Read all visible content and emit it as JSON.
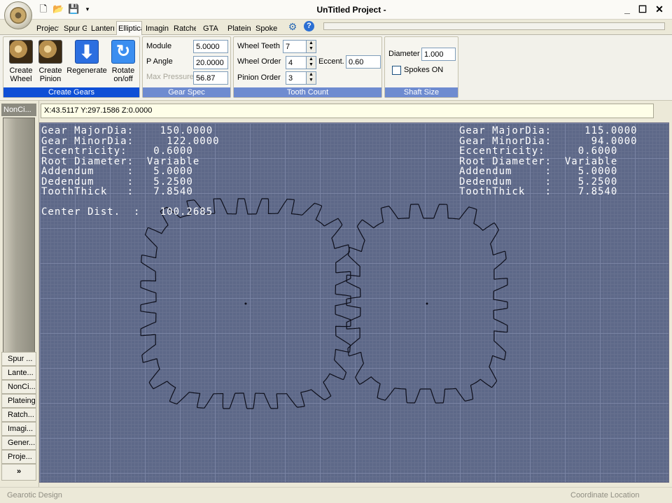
{
  "app": {
    "title": "UnTitled Project -"
  },
  "quick_access": {
    "new_icon": "new-file-icon",
    "open_icon": "open-folder-icon",
    "save_icon": "save-icon",
    "dropdown_icon": "dropdown-icon"
  },
  "tabs": [
    {
      "label": "Project"
    },
    {
      "label": "Spur G"
    },
    {
      "label": "Lantern"
    },
    {
      "label": "Elliptical"
    },
    {
      "label": "Imagin"
    },
    {
      "label": "Ratchet"
    },
    {
      "label": "GTA"
    },
    {
      "label": "Platein"
    },
    {
      "label": "Spoke"
    }
  ],
  "ribbon": {
    "create_gears": {
      "label": "Create Gears",
      "create_wheel": "Create Wheel",
      "create_pinion": "Create Pinion",
      "regenerate": "Regenerate",
      "rotate": "Rotate on/off"
    },
    "gear_spec": {
      "label": "Gear Spec",
      "module_label": "Module",
      "module_value": "5.0000",
      "pangle_label": "P Angle",
      "pangle_value": "20.0000",
      "maxp_label": "Max Pressure",
      "maxp_value": "56.87"
    },
    "tooth_count": {
      "label": "Tooth Count",
      "wheel_teeth_label": "Wheel Teeth",
      "wheel_teeth_value": "7",
      "wheel_order_label": "Wheel Order",
      "wheel_order_value": "4",
      "pinion_order_label": "Pinion Order",
      "pinion_order_value": "3",
      "eccent_label": "Eccent.",
      "eccent_value": "0.60"
    },
    "shaft_size": {
      "label": "Shaft Size",
      "diameter_label": "Diameter",
      "diameter_value": "1.000",
      "spokes_label": "Spokes ON"
    }
  },
  "sidebar": {
    "active_tab": "NonCi...",
    "items": [
      {
        "label": "Spur ..."
      },
      {
        "label": "Lante..."
      },
      {
        "label": "NonCi..."
      },
      {
        "label": "Plateing"
      },
      {
        "label": "Ratch..."
      },
      {
        "label": "Imagi..."
      },
      {
        "label": "Gener..."
      },
      {
        "label": "Proje..."
      }
    ],
    "more": "»"
  },
  "coords": "X:43.5117 Y:297.1586 Z:0.0000",
  "overlay_left": "Gear MajorDia:    150.0000\nGear MinorDia:     122.0000\nEccentricity:    0.6000\nRoot Diameter:  Variable\nAddendum     :   5.0000\nDedendum     :   5.2500\nToothThick   :   7.8540\n\nCenter Dist.  :   100.2685",
  "overlay_right": "Gear MajorDia:     115.0000\nGear MinorDia:      94.0000\nEccentricity:     0.6000\nRoot Diameter:  Variable\nAddendum     :    5.0000\nDedendum     :    5.2500\nToothThick   :    7.8540",
  "status": {
    "left": "Gearotic Design",
    "right": "Coordinate Location"
  },
  "colors": {
    "canvas_bg": "#5d6888",
    "grid_major": "#7a84a4",
    "ribbon_group_label": "#6e8bd0",
    "ribbon_group_label_active": "#0f4fd6"
  }
}
